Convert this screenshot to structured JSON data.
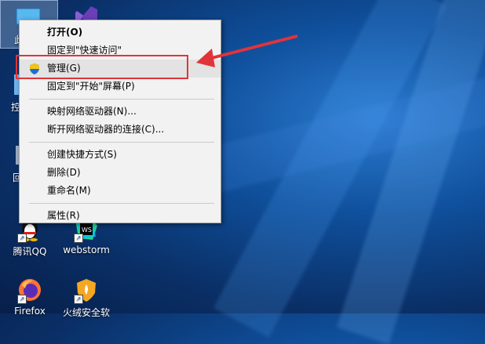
{
  "desktop": {
    "partials": {
      "top": "此",
      "mid1": "控",
      "mid2": "回"
    },
    "icons": [
      {
        "name": "qq",
        "label": "腾讯QQ"
      },
      {
        "name": "webstorm",
        "label": "webstorm"
      },
      {
        "name": "firefox",
        "label": "Firefox"
      },
      {
        "name": "huorong",
        "label": "火绒安全软"
      }
    ]
  },
  "context_menu": {
    "items": [
      {
        "label": "打开(O)"
      },
      {
        "label": "固定到\"快速访问\""
      },
      {
        "label": "管理(G)"
      },
      {
        "label": "固定到\"开始\"屏幕(P)"
      },
      {
        "label": "映射网络驱动器(N)..."
      },
      {
        "label": "断开网络驱动器的连接(C)..."
      },
      {
        "label": "创建快捷方式(S)"
      },
      {
        "label": "删除(D)"
      },
      {
        "label": "重命名(M)"
      },
      {
        "label": "属性(R)"
      }
    ]
  },
  "colors": {
    "highlight": "#e0343a",
    "menu_bg": "#f2f2f2"
  }
}
